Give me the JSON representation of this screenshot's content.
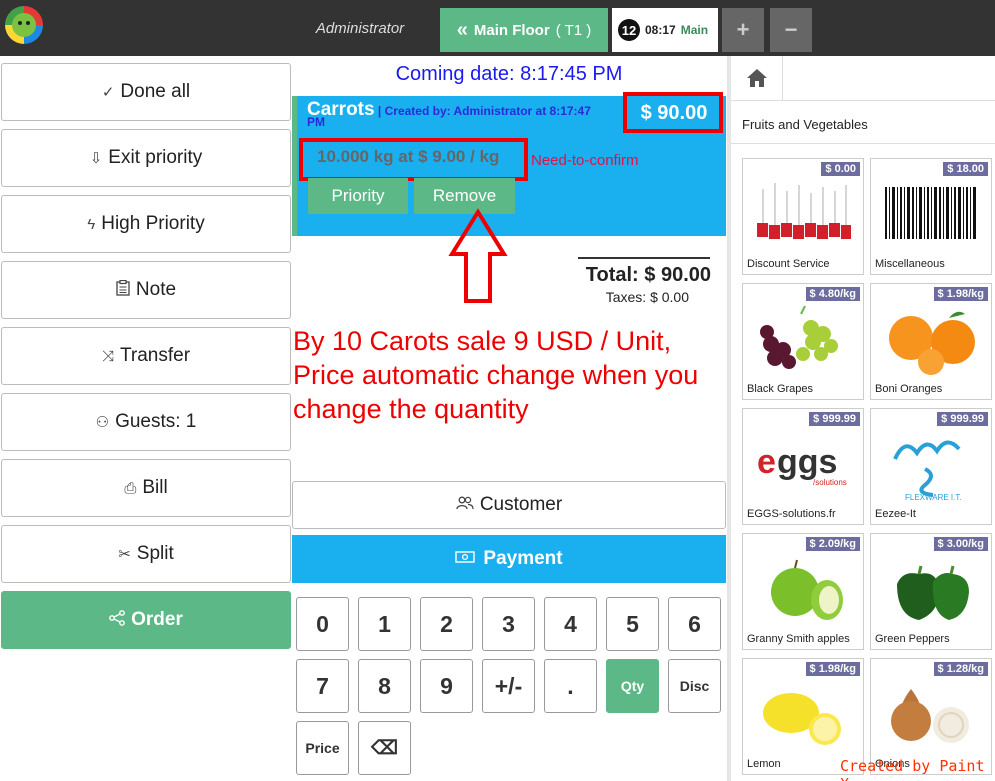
{
  "topbar": {
    "user": "Administrator",
    "floor_tab": {
      "label": "Main Floor",
      "sub": "( T1 )"
    },
    "order_tab": {
      "number": "12",
      "time": "08:17",
      "area": "Main"
    },
    "add_symbol": "+",
    "remove_symbol": "−"
  },
  "actions": [
    {
      "label": "Done all",
      "icon": "check-circle-icon",
      "glyph": "✓"
    },
    {
      "label": "Exit priority",
      "icon": "arrow-down-circle-icon",
      "glyph": "⇩"
    },
    {
      "label": "High Priority",
      "icon": "lightning-icon",
      "glyph": "ϟ"
    },
    {
      "label": "Note",
      "icon": "clipboard-icon",
      "glyph": "📋"
    },
    {
      "label": "Transfer",
      "icon": "shuffle-icon",
      "glyph": "⤨"
    },
    {
      "label": "Guests: 1",
      "icon": "add-user-icon",
      "glyph": "⚇"
    },
    {
      "label": "Bill",
      "icon": "printer-icon",
      "glyph": "⎙"
    },
    {
      "label": "Split",
      "icon": "scissors-icon",
      "glyph": "✂"
    },
    {
      "label": "Order",
      "icon": "share-icon",
      "glyph": "⋖"
    }
  ],
  "order": {
    "coming_date": "Coming date: 8:17:45 PM",
    "line": {
      "product": "Carrots",
      "created_by": "| Created by: Administrator at 8:17:47",
      "created_by_cont": "PM",
      "price": "$ 90.00",
      "qty_text": "10.000 kg at $ 9.00 / kg",
      "status": "Need-to-confirm",
      "priority_btn": "Priority",
      "remove_btn": "Remove"
    },
    "total": "Total: $ 90.00",
    "taxes": "Taxes: $ 0.00"
  },
  "annotation": {
    "lines": [
      "By 10 Carots sale 9 USD / Unit,",
      "Price automatic change when you",
      "change the quantity"
    ],
    "credit": "Created by Paint X",
    "color": "#ee0000"
  },
  "buttons": {
    "customer": "Customer",
    "payment": "Payment"
  },
  "keypad": {
    "row1": [
      "0",
      "1",
      "2",
      "3",
      "4",
      "5",
      "6"
    ],
    "row2": [
      "7",
      "8",
      "9",
      "+/-",
      ".",
      "Qty",
      "Disc"
    ],
    "row3": [
      "Price",
      "⌫"
    ]
  },
  "catalog": {
    "category": "Fruits and Vegetables",
    "products": [
      {
        "name": "Discount Service",
        "price": "$ 0.00"
      },
      {
        "name": "Miscellaneous",
        "price": "$ 18.00"
      },
      {
        "name": "Black Grapes",
        "price": "$ 4.80/kg"
      },
      {
        "name": "Boni Oranges",
        "price": "$ 1.98/kg"
      },
      {
        "name": "EGGS-solutions.fr",
        "price": "$ 999.99"
      },
      {
        "name": "Eezee-It",
        "price": "$ 999.99"
      },
      {
        "name": "Granny Smith apples",
        "price": "$ 2.09/kg"
      },
      {
        "name": "Green Peppers",
        "price": "$ 3.00/kg"
      },
      {
        "name": "Lemon",
        "price": "$ 1.98/kg"
      },
      {
        "name": "Onions",
        "price": "$ 1.28/kg"
      }
    ]
  },
  "colors": {
    "accent_green": "#5cb987",
    "accent_blue": "#1ab0f0",
    "topbar": "#333333",
    "price_badge": "#6c6c9e"
  }
}
